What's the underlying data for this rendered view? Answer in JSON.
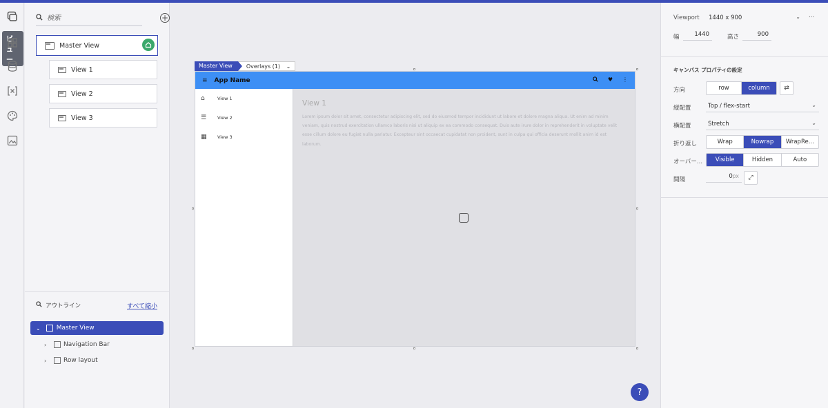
{
  "rail": {
    "tooltip": "ビュー",
    "icons": [
      "views-icon",
      "components-icon",
      "data-icon",
      "variables-icon",
      "theme-icon",
      "assets-icon"
    ]
  },
  "views": {
    "search_placeholder": "検索",
    "items": [
      {
        "label": "Master View"
      },
      {
        "label": "View 1"
      },
      {
        "label": "View 2"
      },
      {
        "label": "View 3"
      }
    ]
  },
  "outline": {
    "title": "アウトライン",
    "collapse_all": "すべて縮小",
    "root": "Master View",
    "children": [
      "Navigation Bar",
      "Row layout"
    ]
  },
  "canvas": {
    "tab_master": "Master View",
    "tab_overlays": "Overlays (1)",
    "app_name": "App Name",
    "nav_items": [
      "View 1",
      "View 2",
      "View 3"
    ],
    "content_title": "View 1",
    "lorem": "Lorem ipsum dolor sit amet, consectetur adipiscing elit, sed do eiusmod tempor incididunt ut labore et dolore magna aliqua. Ut enim ad minim veniam, quis nostrud exercitation ullamco laboris nisi ut aliquip ex ea commodo consequat. Duis aute irure dolor in reprehenderit in voluptate velit esse cillum dolore eu fugiat nulla pariatur. Excepteur sint occaecat cupidatat non proident, sunt in culpa qui officia deserunt mollit anim id est laborum.",
    "help": "?"
  },
  "props": {
    "viewport_label": "Viewport",
    "viewport_value": "1440 x 900",
    "more": "···",
    "width_label": "幅",
    "width_value": "1440",
    "height_label": "高さ",
    "height_value": "900",
    "section_title": "キャンバス プロパティの設定",
    "direction_label": "方向",
    "direction_options": [
      "row",
      "column"
    ],
    "direction_selected": "column",
    "vertical_label": "縦配置",
    "vertical_value": "Top / flex-start",
    "horizontal_label": "横配置",
    "horizontal_value": "Stretch",
    "wrap_label": "折り返し",
    "wrap_options": [
      "Wrap",
      "Nowrap",
      "WrapRe..."
    ],
    "wrap_selected": "Nowrap",
    "overflow_label": "オーバー...",
    "overflow_options": [
      "Visible",
      "Hidden",
      "Auto"
    ],
    "overflow_selected": "Visible",
    "gap_label": "間隔",
    "gap_value": "0",
    "gap_unit": "px"
  },
  "colors": {
    "accent": "#3b4db8",
    "appbar": "#3d8ff5",
    "home_badge": "#3aa86b"
  }
}
